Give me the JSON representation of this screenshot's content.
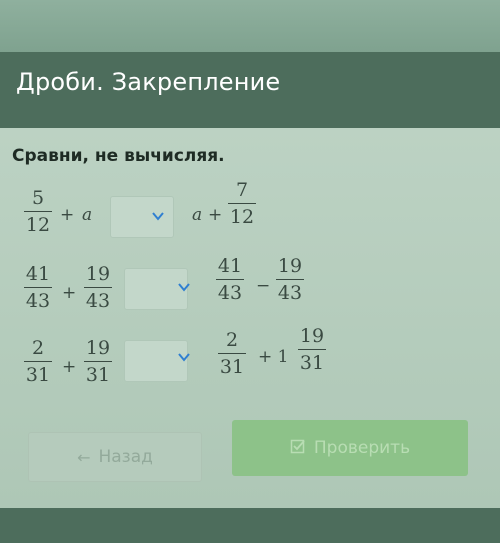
{
  "title": "Дроби. Закрепление",
  "instruction": "Сравни, не вычисляя.",
  "icons": {
    "dropdown": "chevron-down-icon",
    "back": "arrow-left-icon",
    "check": "checkbox-icon"
  },
  "colors": {
    "accent": "#8dc289",
    "chevron": "#2f7fd1"
  },
  "rows": [
    {
      "left": {
        "f1": {
          "num": "5",
          "den": "12"
        },
        "op": "+",
        "var": "a"
      },
      "right": {
        "var": "a",
        "op": "+",
        "f1": {
          "num": "7",
          "den": "12"
        }
      }
    },
    {
      "left": {
        "f1": {
          "num": "41",
          "den": "43"
        },
        "op": "+",
        "f2": {
          "num": "19",
          "den": "43"
        }
      },
      "right": {
        "f1": {
          "num": "41",
          "den": "43"
        },
        "op": "−",
        "f2": {
          "num": "19",
          "den": "43"
        }
      }
    },
    {
      "left": {
        "f1": {
          "num": "2",
          "den": "31"
        },
        "op": "+",
        "f2": {
          "num": "19",
          "den": "31"
        }
      },
      "right": {
        "f1": {
          "num": "2",
          "den": "31"
        },
        "op": "+ 1",
        "f2": {
          "num": "19",
          "den": "31"
        }
      }
    }
  ],
  "buttons": {
    "back": "Назад",
    "check": "Проверить"
  }
}
